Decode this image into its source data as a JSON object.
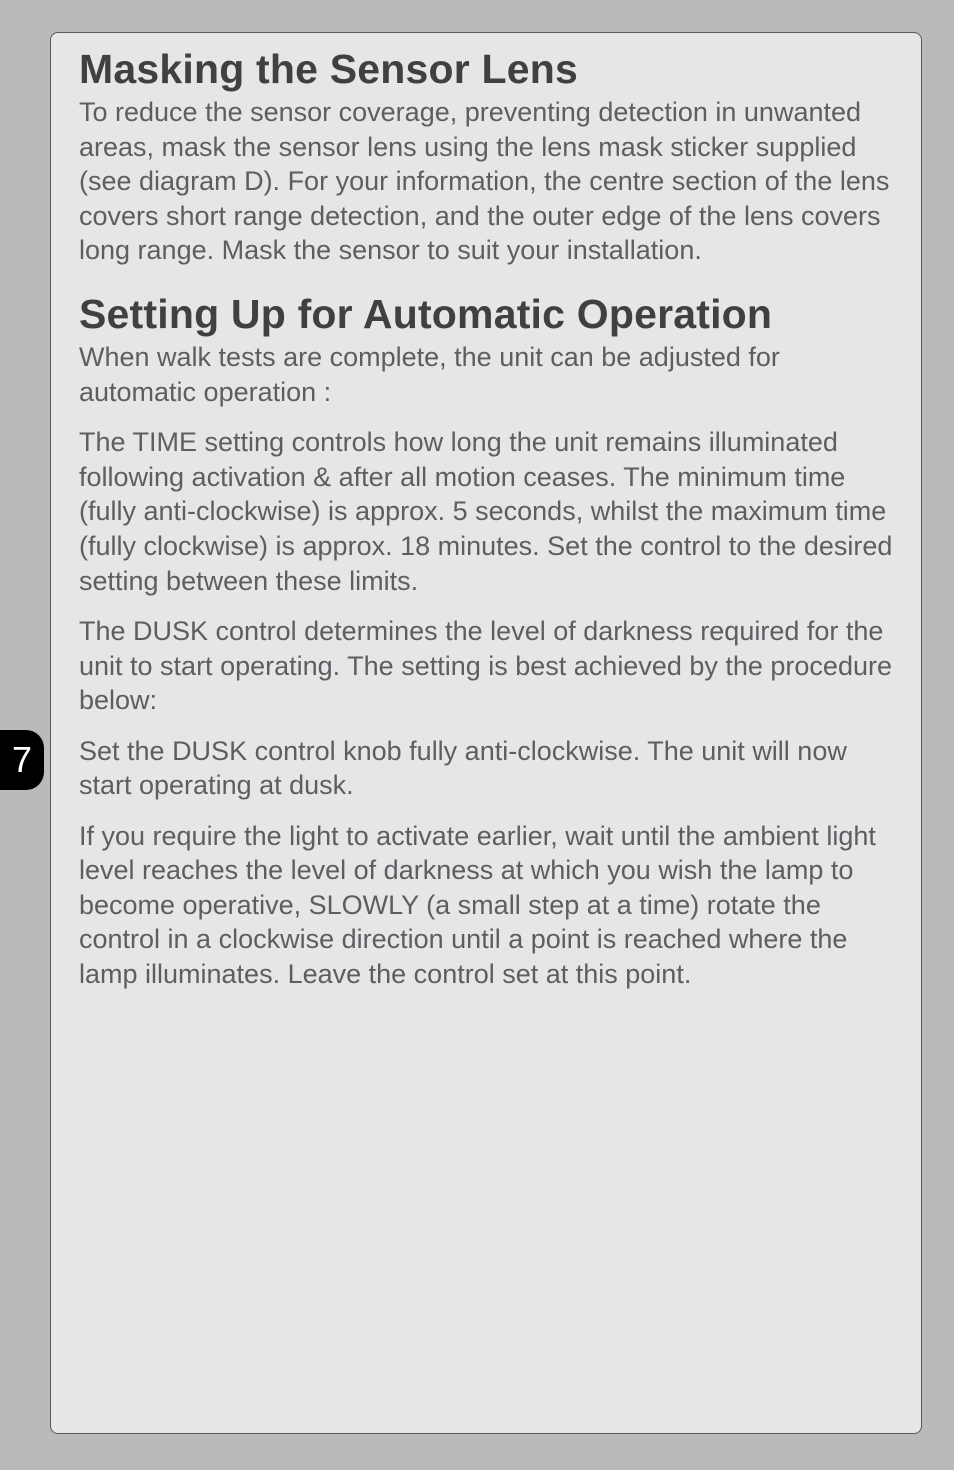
{
  "page_number": "7",
  "section1": {
    "heading": "Masking the Sensor Lens",
    "p1": "To reduce the sensor coverage, preventing detection in unwanted areas, mask the sensor lens using the lens mask sticker supplied (see diagram D). For your information, the centre section of the lens covers short range detection, and the outer edge of the lens covers long range. Mask the sensor to suit your installation."
  },
  "section2": {
    "heading": "Setting Up for Automatic Operation",
    "p1": "When walk tests are complete, the unit can be adjusted for automatic operation :",
    "p2": "The TIME setting controls how long the unit remains illuminated following activation & after all motion ceases. The minimum time (fully anti-clockwise) is approx. 5 seconds, whilst the maximum time (fully clockwise) is approx. 18 minutes. Set the control to the desired setting between these limits.",
    "p3": "The DUSK control determines the level of darkness required for the unit to start operating. The setting is best achieved by the procedure below:",
    "p4": "Set the DUSK control knob fully anti-clockwise. The unit will now start operating at dusk.",
    "p5": "If you require the light to activate earlier, wait until the ambient light level reaches the level of darkness at which you wish the lamp to become operative, SLOWLY (a small step at a time) rotate the control in a clockwise direction until a point is reached where the lamp illuminates. Leave the control set at this point."
  }
}
